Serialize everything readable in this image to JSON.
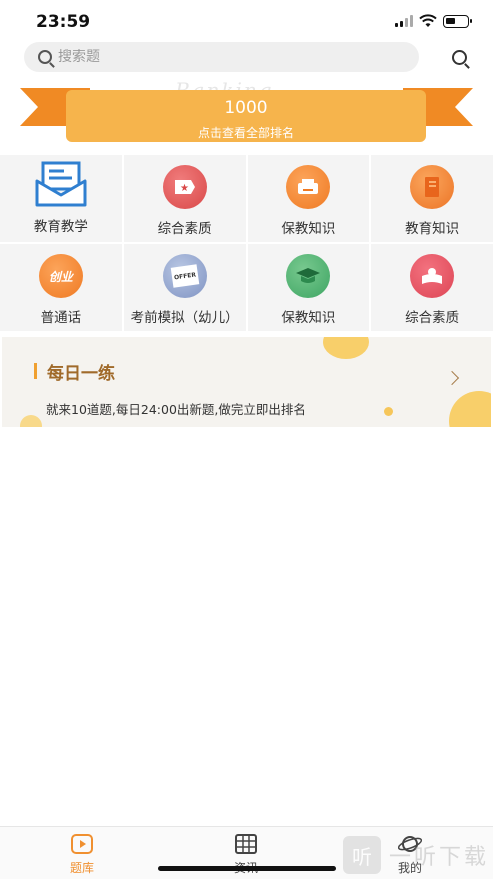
{
  "status_bar": {
    "time": "23:59"
  },
  "search": {
    "placeholder": "搜索题"
  },
  "banner": {
    "ghost_text": "Ranking",
    "score": "1000",
    "link": "点击查看全部排名"
  },
  "grid": {
    "row1": [
      {
        "label": "教育教学",
        "icon": "envelope-icon"
      },
      {
        "label": "综合素质",
        "icon": "ticket-icon"
      },
      {
        "label": "保教知识",
        "icon": "printer-icon"
      },
      {
        "label": "教育知识",
        "icon": "book-icon"
      }
    ],
    "row2": [
      {
        "label": "普通话",
        "icon": "chuangye-icon",
        "icon_text": "创业"
      },
      {
        "label": "考前模拟（幼儿）",
        "icon": "offer-icon",
        "icon_text": "OFFER"
      },
      {
        "label": "保教知识",
        "icon": "graduation-cap-icon"
      },
      {
        "label": "综合素质",
        "icon": "reading-icon"
      }
    ]
  },
  "daily": {
    "title": "每日一练",
    "desc": "就来10道题,每日24:00出新题,做完立即出排名"
  },
  "tabs": [
    {
      "label": "题库",
      "icon": "play-icon",
      "active": true
    },
    {
      "label": "资讯",
      "icon": "grid-icon",
      "active": false
    },
    {
      "label": "我的",
      "icon": "planet-icon",
      "active": false
    }
  ],
  "watermark": {
    "glyph": "听",
    "text": "一听下载"
  },
  "colors": {
    "accent": "#f09030",
    "banner": "#f6b44c",
    "ribbon": "#f08a24"
  }
}
